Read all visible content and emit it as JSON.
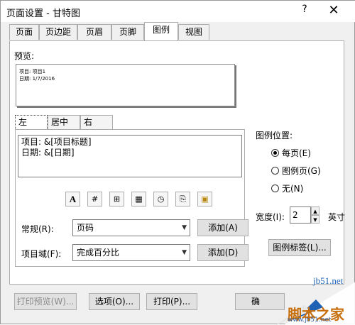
{
  "window": {
    "title": "页面设置 - 甘特图",
    "help": "?",
    "close": "✕"
  },
  "tabs": [
    {
      "label": "页面"
    },
    {
      "label": "页边距"
    },
    {
      "label": "页眉"
    },
    {
      "label": "页脚"
    },
    {
      "label": "图例",
      "active": true
    },
    {
      "label": "视图"
    }
  ],
  "preview": {
    "label": "预览:",
    "line1": "项目: 项目1",
    "line2": "日期: 1/7/2016"
  },
  "alignment_tabs": [
    {
      "label": "左",
      "active": true
    },
    {
      "label": "居中"
    },
    {
      "label": "右"
    }
  ],
  "editor": {
    "line1": "项目: &[项目标题]",
    "line2": "日期: &[日期]"
  },
  "toolbar_icons": [
    {
      "name": "font-icon",
      "glyph": "A"
    },
    {
      "name": "insert-page-number-icon",
      "glyph": "#"
    },
    {
      "name": "insert-page-count-icon",
      "glyph": "⊞"
    },
    {
      "name": "insert-date-icon",
      "glyph": "▦"
    },
    {
      "name": "insert-time-icon",
      "glyph": "◷"
    },
    {
      "name": "insert-file-name-icon",
      "glyph": "⎘"
    },
    {
      "name": "insert-picture-icon",
      "glyph": "▣"
    }
  ],
  "general": {
    "label": "常规(R):",
    "value": "页码",
    "add_label": "添加(A)"
  },
  "project_field": {
    "label": "项目域(F):",
    "value": "完成百分比",
    "add_label": "添加(D)"
  },
  "legend_position": {
    "label": "图例位置:",
    "options": [
      {
        "label": "每页(E)",
        "checked": true
      },
      {
        "label": "图例页(G)",
        "checked": false
      },
      {
        "label": "无(N)",
        "checked": false
      }
    ]
  },
  "width": {
    "label": "宽度(I):",
    "value": "2",
    "unit": "英寸"
  },
  "legend_labels_button": "图例标签(L)...",
  "bottom_buttons": {
    "print_preview": "打印预览(W)...",
    "options": "选项(O)...",
    "print": "打印(P)...",
    "ok": "确"
  },
  "watermark": {
    "brand": "jb51.net",
    "text": "脚本之家",
    "url": "www.jb51.net"
  },
  "colors": {
    "watermark_text": "#c86f0d",
    "watermark_brand": "#1d62b5"
  }
}
